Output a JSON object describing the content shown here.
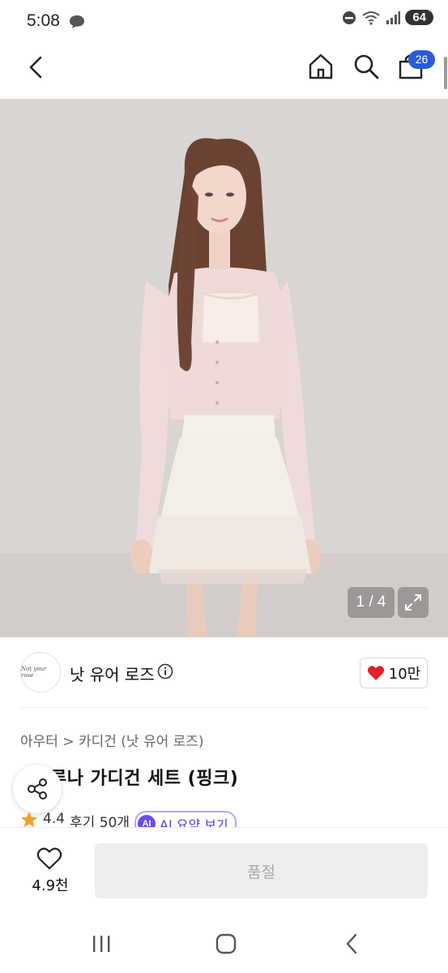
{
  "status_bar": {
    "time": "5:08",
    "battery": "64"
  },
  "nav": {
    "cart_count": "26"
  },
  "gallery": {
    "counter": "1 / 4"
  },
  "brand": {
    "logo_text": "Not your rose",
    "name": "낫 유어 로즈",
    "likes": "10만"
  },
  "product": {
    "breadcrumb": "아우터 > 카디건 (낫 유어 로즈)",
    "title": "루나 가디건 세트 (핑크)",
    "rating": "4.4",
    "reviews": "후기 50개",
    "ai_badge": "AI",
    "ai_label": "AI 요약 보기"
  },
  "bottom_bar": {
    "wish_count": "4.9천",
    "buy_label": "품절"
  },
  "colors": {
    "accent_blue": "#2a5bd7",
    "heart_red": "#e0202a",
    "ai_purple": "#6c4bf0",
    "star_orange": "#f2a227"
  }
}
